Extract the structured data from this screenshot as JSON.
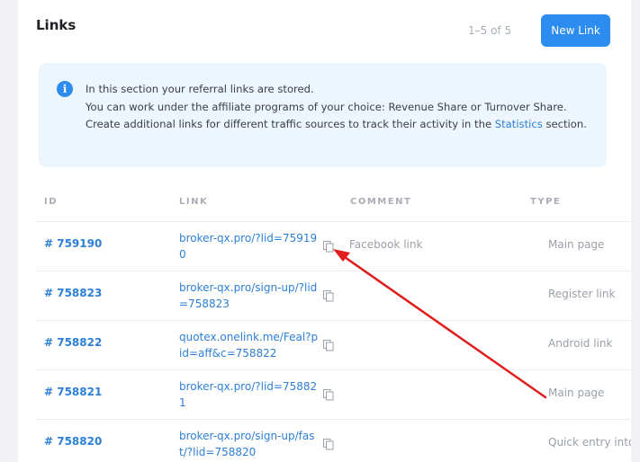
{
  "header": {
    "title": "Links",
    "pager": "1–5 of 5",
    "new_link_label": "New Link"
  },
  "info": {
    "icon": "info-icon",
    "line1": "In this section your referral links are stored.",
    "line2_before": "You can work under the affiliate programs of your choice: Revenue Share or Turnover Share. Create additional links for different traffic sources to track their activity in the ",
    "statistics_link": "Statistics",
    "line2_after": " section."
  },
  "table": {
    "headers": [
      "ID",
      "LINK",
      "COMMENT",
      "TYPE"
    ],
    "rows": [
      {
        "id": "# 759190",
        "link": "broker-qx.pro/?lid=759190",
        "comment": "Facebook link",
        "type": "Main page"
      },
      {
        "id": "# 758823",
        "link": "broker-qx.pro/sign-up/?lid=758823",
        "comment": "",
        "type": "Register link"
      },
      {
        "id": "# 758822",
        "link": "quotex.onelink.me/Feal?pid=aff&c=758822",
        "comment": "",
        "type": "Android link"
      },
      {
        "id": "# 758821",
        "link": "broker-qx.pro/?lid=758821",
        "comment": "",
        "type": "Main page"
      },
      {
        "id": "# 758820",
        "link": "broker-qx.pro/sign-up/fast/?lid=758820",
        "comment": "",
        "type": "Quick entry into"
      }
    ]
  },
  "colors": {
    "accent": "#2d8cf0",
    "annotation_arrow": "#e01e1e"
  }
}
